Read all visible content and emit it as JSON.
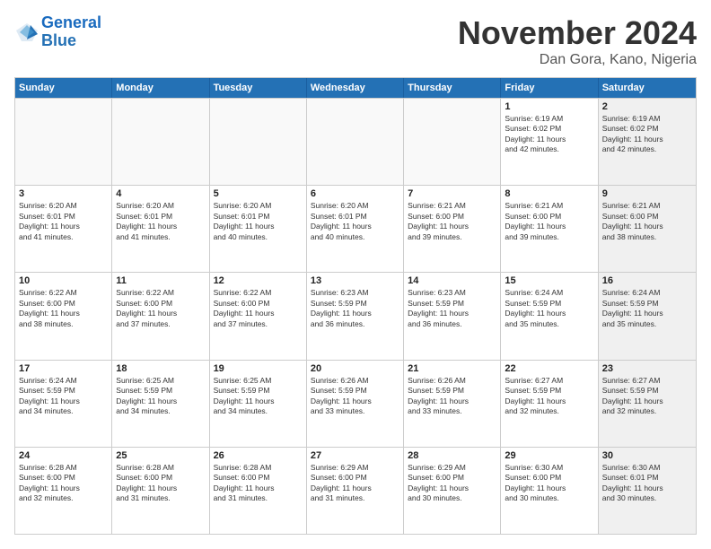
{
  "header": {
    "logo_line1": "General",
    "logo_line2": "Blue",
    "month": "November 2024",
    "location": "Dan Gora, Kano, Nigeria"
  },
  "weekdays": [
    "Sunday",
    "Monday",
    "Tuesday",
    "Wednesday",
    "Thursday",
    "Friday",
    "Saturday"
  ],
  "rows": [
    [
      {
        "day": "",
        "empty": true
      },
      {
        "day": "",
        "empty": true
      },
      {
        "day": "",
        "empty": true
      },
      {
        "day": "",
        "empty": true
      },
      {
        "day": "",
        "empty": true
      },
      {
        "day": "1",
        "info": "Sunrise: 6:19 AM\nSunset: 6:02 PM\nDaylight: 11 hours\nand 42 minutes."
      },
      {
        "day": "2",
        "info": "Sunrise: 6:19 AM\nSunset: 6:02 PM\nDaylight: 11 hours\nand 42 minutes."
      }
    ],
    [
      {
        "day": "3",
        "info": "Sunrise: 6:20 AM\nSunset: 6:01 PM\nDaylight: 11 hours\nand 41 minutes."
      },
      {
        "day": "4",
        "info": "Sunrise: 6:20 AM\nSunset: 6:01 PM\nDaylight: 11 hours\nand 41 minutes."
      },
      {
        "day": "5",
        "info": "Sunrise: 6:20 AM\nSunset: 6:01 PM\nDaylight: 11 hours\nand 40 minutes."
      },
      {
        "day": "6",
        "info": "Sunrise: 6:20 AM\nSunset: 6:01 PM\nDaylight: 11 hours\nand 40 minutes."
      },
      {
        "day": "7",
        "info": "Sunrise: 6:21 AM\nSunset: 6:00 PM\nDaylight: 11 hours\nand 39 minutes."
      },
      {
        "day": "8",
        "info": "Sunrise: 6:21 AM\nSunset: 6:00 PM\nDaylight: 11 hours\nand 39 minutes."
      },
      {
        "day": "9",
        "info": "Sunrise: 6:21 AM\nSunset: 6:00 PM\nDaylight: 11 hours\nand 38 minutes."
      }
    ],
    [
      {
        "day": "10",
        "info": "Sunrise: 6:22 AM\nSunset: 6:00 PM\nDaylight: 11 hours\nand 38 minutes."
      },
      {
        "day": "11",
        "info": "Sunrise: 6:22 AM\nSunset: 6:00 PM\nDaylight: 11 hours\nand 37 minutes."
      },
      {
        "day": "12",
        "info": "Sunrise: 6:22 AM\nSunset: 6:00 PM\nDaylight: 11 hours\nand 37 minutes."
      },
      {
        "day": "13",
        "info": "Sunrise: 6:23 AM\nSunset: 5:59 PM\nDaylight: 11 hours\nand 36 minutes."
      },
      {
        "day": "14",
        "info": "Sunrise: 6:23 AM\nSunset: 5:59 PM\nDaylight: 11 hours\nand 36 minutes."
      },
      {
        "day": "15",
        "info": "Sunrise: 6:24 AM\nSunset: 5:59 PM\nDaylight: 11 hours\nand 35 minutes."
      },
      {
        "day": "16",
        "info": "Sunrise: 6:24 AM\nSunset: 5:59 PM\nDaylight: 11 hours\nand 35 minutes."
      }
    ],
    [
      {
        "day": "17",
        "info": "Sunrise: 6:24 AM\nSunset: 5:59 PM\nDaylight: 11 hours\nand 34 minutes."
      },
      {
        "day": "18",
        "info": "Sunrise: 6:25 AM\nSunset: 5:59 PM\nDaylight: 11 hours\nand 34 minutes."
      },
      {
        "day": "19",
        "info": "Sunrise: 6:25 AM\nSunset: 5:59 PM\nDaylight: 11 hours\nand 34 minutes."
      },
      {
        "day": "20",
        "info": "Sunrise: 6:26 AM\nSunset: 5:59 PM\nDaylight: 11 hours\nand 33 minutes."
      },
      {
        "day": "21",
        "info": "Sunrise: 6:26 AM\nSunset: 5:59 PM\nDaylight: 11 hours\nand 33 minutes."
      },
      {
        "day": "22",
        "info": "Sunrise: 6:27 AM\nSunset: 5:59 PM\nDaylight: 11 hours\nand 32 minutes."
      },
      {
        "day": "23",
        "info": "Sunrise: 6:27 AM\nSunset: 5:59 PM\nDaylight: 11 hours\nand 32 minutes."
      }
    ],
    [
      {
        "day": "24",
        "info": "Sunrise: 6:28 AM\nSunset: 6:00 PM\nDaylight: 11 hours\nand 32 minutes."
      },
      {
        "day": "25",
        "info": "Sunrise: 6:28 AM\nSunset: 6:00 PM\nDaylight: 11 hours\nand 31 minutes."
      },
      {
        "day": "26",
        "info": "Sunrise: 6:28 AM\nSunset: 6:00 PM\nDaylight: 11 hours\nand 31 minutes."
      },
      {
        "day": "27",
        "info": "Sunrise: 6:29 AM\nSunset: 6:00 PM\nDaylight: 11 hours\nand 31 minutes."
      },
      {
        "day": "28",
        "info": "Sunrise: 6:29 AM\nSunset: 6:00 PM\nDaylight: 11 hours\nand 30 minutes."
      },
      {
        "day": "29",
        "info": "Sunrise: 6:30 AM\nSunset: 6:00 PM\nDaylight: 11 hours\nand 30 minutes."
      },
      {
        "day": "30",
        "info": "Sunrise: 6:30 AM\nSunset: 6:01 PM\nDaylight: 11 hours\nand 30 minutes."
      }
    ]
  ]
}
